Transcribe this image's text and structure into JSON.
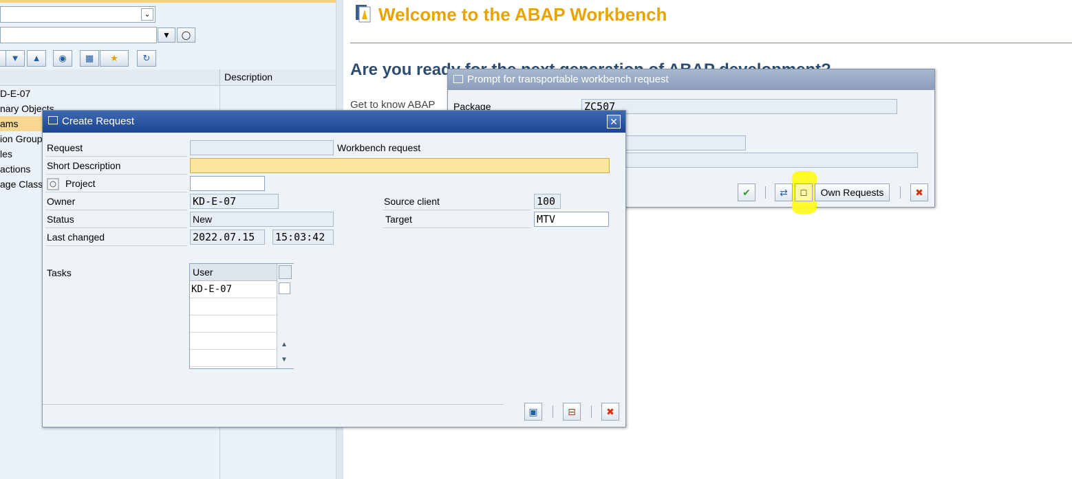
{
  "left_nav": {
    "tree_header_description": "Description",
    "rows": [
      {
        "label": "D-E-07"
      },
      {
        "label": "nary Objects"
      },
      {
        "label": "ams"
      },
      {
        "label": "ion Group"
      },
      {
        "label": "les"
      },
      {
        "label": "actions"
      },
      {
        "label": "age Classe"
      }
    ]
  },
  "welcome": {
    "title": "Welcome to the ABAP Workbench",
    "subtitle": "Are you ready for the next generation of ABAP development?",
    "get_to_know": "Get to know ABAP"
  },
  "prompt_dialog": {
    "title": "Prompt for transportable workbench request",
    "package_label": "Package",
    "package_value": "ZC507",
    "own_requests_label": "Own Requests"
  },
  "create_dialog": {
    "title": "Create Request",
    "request_label": "Request",
    "request_value": "",
    "request_type": "Workbench request",
    "short_desc_label": "Short Description",
    "short_desc_value": "",
    "project_label": "Project",
    "project_value": "",
    "owner_label": "Owner",
    "owner_value": "KD-E-07",
    "status_label": "Status",
    "status_value": "New",
    "last_changed_label": "Last changed",
    "last_changed_date": "2022.07.15",
    "last_changed_time": "15:03:42",
    "source_client_label": "Source client",
    "source_client_value": "100",
    "target_label": "Target",
    "target_value": "MTV",
    "tasks_label": "Tasks",
    "tasks_header": "User",
    "tasks": [
      "KD-E-07",
      "",
      "",
      "",
      ""
    ]
  },
  "colors": {
    "highlight": "#fffb1f",
    "title_orange": "#e8a300",
    "subtitle_blue": "#2d4d70",
    "dialog_title_blue": "#1e4691"
  }
}
